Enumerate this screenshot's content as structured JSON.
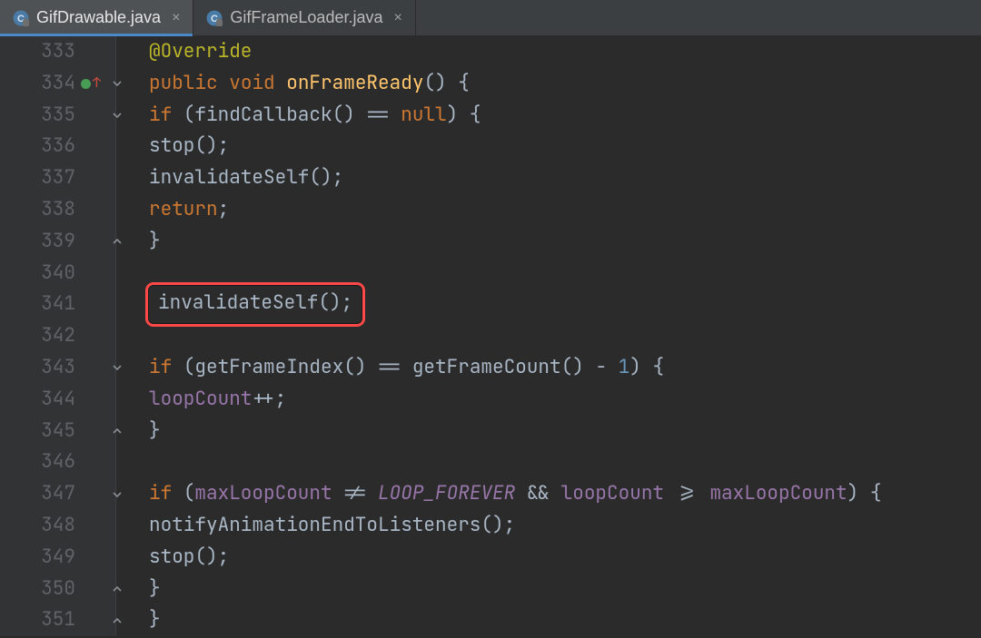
{
  "tabs": [
    {
      "label": "GifDrawable.java",
      "active": true
    },
    {
      "label": "GifFrameLoader.java",
      "active": false
    }
  ],
  "gutter_start": 333,
  "code_lines": [
    {
      "n": 333,
      "fold": null,
      "marks": [],
      "tokens": [
        {
          "indent": 1
        },
        {
          "t": "@Override",
          "cls": "tk-ann"
        }
      ]
    },
    {
      "n": 334,
      "fold": "open",
      "marks": [
        "override",
        "up"
      ],
      "tokens": [
        {
          "indent": 1
        },
        {
          "t": "public",
          "cls": "tk-kw"
        },
        {
          "t": " "
        },
        {
          "t": "void",
          "cls": "tk-kw"
        },
        {
          "t": " "
        },
        {
          "t": "onFrameReady",
          "cls": "tk-fn"
        },
        {
          "t": "()",
          "cls": "tk-pun"
        },
        {
          "t": " {",
          "cls": "tk-pun"
        }
      ]
    },
    {
      "n": 335,
      "fold": "open",
      "marks": [],
      "tokens": [
        {
          "indent": 2
        },
        {
          "t": "if",
          "cls": "tk-kw"
        },
        {
          "t": " (",
          "cls": "tk-pun"
        },
        {
          "t": "findCallback",
          "cls": "tk-id"
        },
        {
          "t": "()",
          "cls": "tk-pun"
        },
        {
          "t": " == ",
          "cls": "tk-op"
        },
        {
          "t": "null",
          "cls": "tk-kw"
        },
        {
          "t": ") {",
          "cls": "tk-pun"
        }
      ]
    },
    {
      "n": 336,
      "fold": null,
      "marks": [],
      "tokens": [
        {
          "indent": 3
        },
        {
          "t": "stop",
          "cls": "tk-id"
        },
        {
          "t": "();",
          "cls": "tk-pun"
        }
      ]
    },
    {
      "n": 337,
      "fold": null,
      "marks": [],
      "tokens": [
        {
          "indent": 3
        },
        {
          "t": "invalidateSelf",
          "cls": "tk-id"
        },
        {
          "t": "();",
          "cls": "tk-pun"
        }
      ]
    },
    {
      "n": 338,
      "fold": null,
      "marks": [],
      "tokens": [
        {
          "indent": 3
        },
        {
          "t": "return",
          "cls": "tk-kw"
        },
        {
          "t": ";",
          "cls": "tk-pun"
        }
      ]
    },
    {
      "n": 339,
      "fold": "close",
      "marks": [],
      "tokens": [
        {
          "indent": 2
        },
        {
          "t": "}",
          "cls": "tk-pun"
        }
      ]
    },
    {
      "n": 340,
      "fold": null,
      "marks": [],
      "tokens": []
    },
    {
      "n": 341,
      "fold": null,
      "marks": [],
      "callout": true,
      "tokens": [
        {
          "indent": 2
        },
        {
          "t": "invalidateSelf",
          "cls": "tk-id"
        },
        {
          "t": "();",
          "cls": "tk-pun"
        }
      ]
    },
    {
      "n": 342,
      "fold": null,
      "marks": [],
      "tokens": []
    },
    {
      "n": 343,
      "fold": "open",
      "marks": [],
      "tokens": [
        {
          "indent": 2
        },
        {
          "t": "if",
          "cls": "tk-kw"
        },
        {
          "t": " (",
          "cls": "tk-pun"
        },
        {
          "t": "getFrameIndex",
          "cls": "tk-id"
        },
        {
          "t": "()",
          "cls": "tk-pun"
        },
        {
          "t": " == ",
          "cls": "tk-op"
        },
        {
          "t": "getFrameCount",
          "cls": "tk-id"
        },
        {
          "t": "()",
          "cls": "tk-pun"
        },
        {
          "t": " - ",
          "cls": "tk-op"
        },
        {
          "t": "1",
          "cls": "tk-num"
        },
        {
          "t": ") {",
          "cls": "tk-pun"
        }
      ]
    },
    {
      "n": 344,
      "fold": null,
      "marks": [],
      "tokens": [
        {
          "indent": 3
        },
        {
          "t": "loopCount",
          "cls": "tk-field"
        },
        {
          "t": "++;",
          "cls": "tk-pun"
        }
      ]
    },
    {
      "n": 345,
      "fold": "close",
      "marks": [],
      "tokens": [
        {
          "indent": 2
        },
        {
          "t": "}",
          "cls": "tk-pun"
        }
      ]
    },
    {
      "n": 346,
      "fold": null,
      "marks": [],
      "tokens": []
    },
    {
      "n": 347,
      "fold": "open",
      "marks": [],
      "tokens": [
        {
          "indent": 2
        },
        {
          "t": "if",
          "cls": "tk-kw"
        },
        {
          "t": " (",
          "cls": "tk-pun"
        },
        {
          "t": "maxLoopCount",
          "cls": "tk-field"
        },
        {
          "t": " != ",
          "cls": "tk-op"
        },
        {
          "t": "LOOP_FOREVER",
          "cls": "tk-const"
        },
        {
          "t": " && ",
          "cls": "tk-op"
        },
        {
          "t": "loopCount",
          "cls": "tk-field"
        },
        {
          "t": " >= ",
          "cls": "tk-op"
        },
        {
          "t": "maxLoopCount",
          "cls": "tk-field"
        },
        {
          "t": ") {",
          "cls": "tk-pun"
        }
      ]
    },
    {
      "n": 348,
      "fold": null,
      "marks": [],
      "tokens": [
        {
          "indent": 3
        },
        {
          "t": "notifyAnimationEndToListeners",
          "cls": "tk-id"
        },
        {
          "t": "();",
          "cls": "tk-pun"
        }
      ]
    },
    {
      "n": 349,
      "fold": null,
      "marks": [],
      "tokens": [
        {
          "indent": 3
        },
        {
          "t": "stop",
          "cls": "tk-id"
        },
        {
          "t": "();",
          "cls": "tk-pun"
        }
      ]
    },
    {
      "n": 350,
      "fold": "close",
      "marks": [],
      "tokens": [
        {
          "indent": 2
        },
        {
          "t": "}",
          "cls": "tk-pun"
        }
      ]
    },
    {
      "n": 351,
      "fold": "close",
      "marks": [],
      "tokens": [
        {
          "indent": 1
        },
        {
          "t": "}",
          "cls": "tk-pun"
        }
      ]
    }
  ],
  "icons": {
    "java_class": "C",
    "close": "×"
  }
}
